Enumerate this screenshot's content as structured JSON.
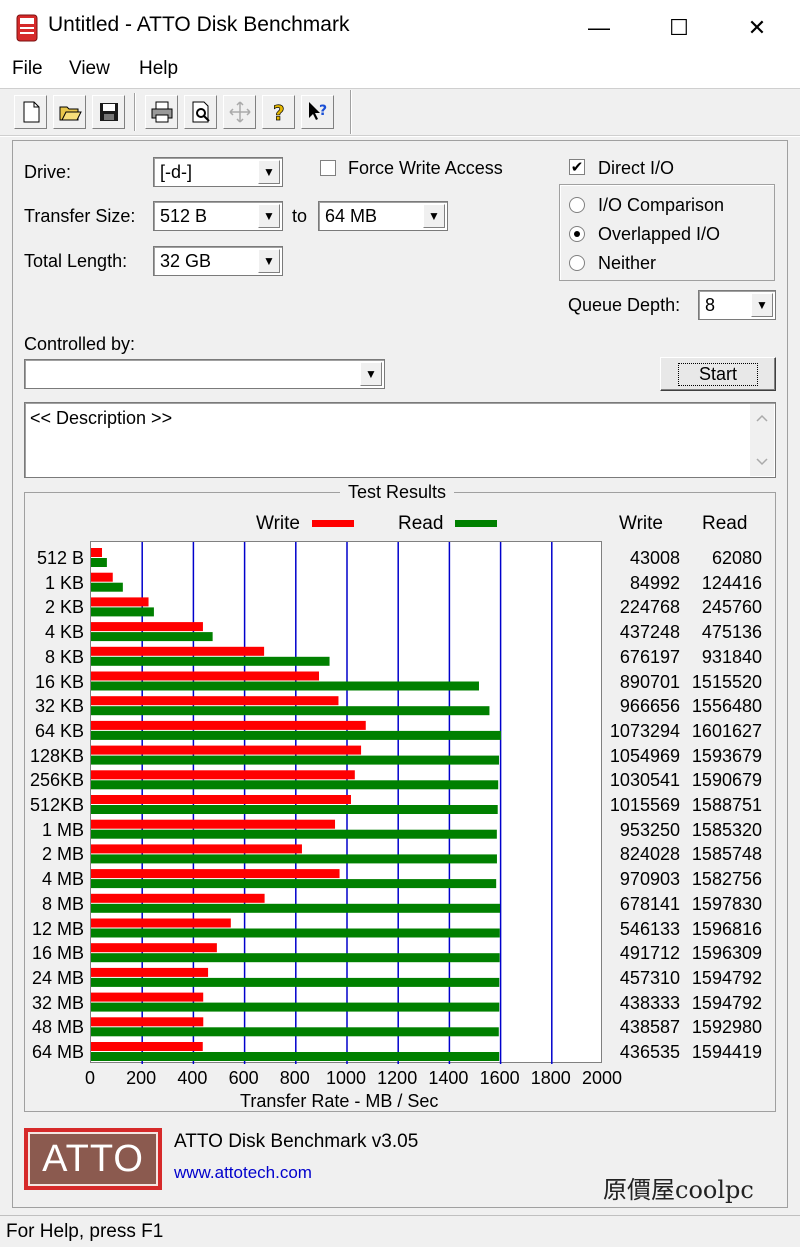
{
  "window": {
    "title": "Untitled - ATTO Disk Benchmark",
    "min_glyph": "—",
    "max_glyph": "☐",
    "close_glyph": "✕"
  },
  "menu": {
    "file": "File",
    "view": "View",
    "help": "Help"
  },
  "toolbar": {
    "icons": [
      "new-icon",
      "open-icon",
      "save-icon",
      "print-icon",
      "print-preview-icon",
      "move-icon",
      "help-icon",
      "context-help-icon"
    ]
  },
  "form": {
    "drive_label": "Drive:",
    "drive_value": "[-d-]",
    "force_write_label": "Force Write Access",
    "force_write_checked": false,
    "direct_io_label": "Direct I/O",
    "direct_io_checked": true,
    "transfer_size_label": "Transfer Size:",
    "transfer_from": "512 B",
    "to_label": "to",
    "transfer_to": "64 MB",
    "total_length_label": "Total Length:",
    "total_length_value": "32 GB",
    "io_options": [
      "I/O Comparison",
      "Overlapped I/O",
      "Neither"
    ],
    "io_selected": 1,
    "queue_depth_label": "Queue Depth:",
    "queue_depth_value": "8",
    "controlled_by_label": "Controlled by:",
    "controlled_by_value": "",
    "start_label": "Start",
    "description": "<< Description >>"
  },
  "results": {
    "group_title": "Test Results",
    "legend_write": "Write",
    "legend_read": "Read",
    "col_write": "Write",
    "col_read": "Read"
  },
  "colors": {
    "write": "#ff0000",
    "read": "#008000",
    "grid": "#0000cc"
  },
  "chart_data": {
    "type": "bar",
    "orientation": "horizontal",
    "xlabel": "Transfer Rate - MB / Sec",
    "xlim": [
      0,
      2000
    ],
    "xticks": [
      0,
      200,
      400,
      600,
      800,
      1000,
      1200,
      1400,
      1600,
      1800,
      2000
    ],
    "grid": true,
    "categories": [
      "512 B",
      "1 KB",
      "2 KB",
      "4 KB",
      "8 KB",
      "16 KB",
      "32 KB",
      "64 KB",
      "128KB",
      "256KB",
      "512KB",
      "1 MB",
      "2 MB",
      "4 MB",
      "8 MB",
      "12 MB",
      "16 MB",
      "24 MB",
      "32 MB",
      "48 MB",
      "64 MB"
    ],
    "series": [
      {
        "name": "Write",
        "values": [
          43008,
          84992,
          224768,
          437248,
          676197,
          890701,
          966656,
          1073294,
          1054969,
          1030541,
          1015569,
          953250,
          824028,
          970903,
          678141,
          546133,
          491712,
          457310,
          438333,
          438587,
          436535
        ]
      },
      {
        "name": "Read",
        "values": [
          62080,
          124416,
          245760,
          475136,
          931840,
          1515520,
          1556480,
          1601627,
          1593679,
          1590679,
          1588751,
          1585320,
          1585748,
          1582756,
          1597830,
          1596816,
          1596309,
          1594792,
          1594792,
          1592980,
          1594419
        ]
      }
    ]
  },
  "footer": {
    "logo_text": "ATTO",
    "version": "ATTO Disk Benchmark v3.05",
    "url": "www.attotech.com",
    "watermark": "原價屋coolpc"
  },
  "status": {
    "text": "For Help, press F1"
  }
}
